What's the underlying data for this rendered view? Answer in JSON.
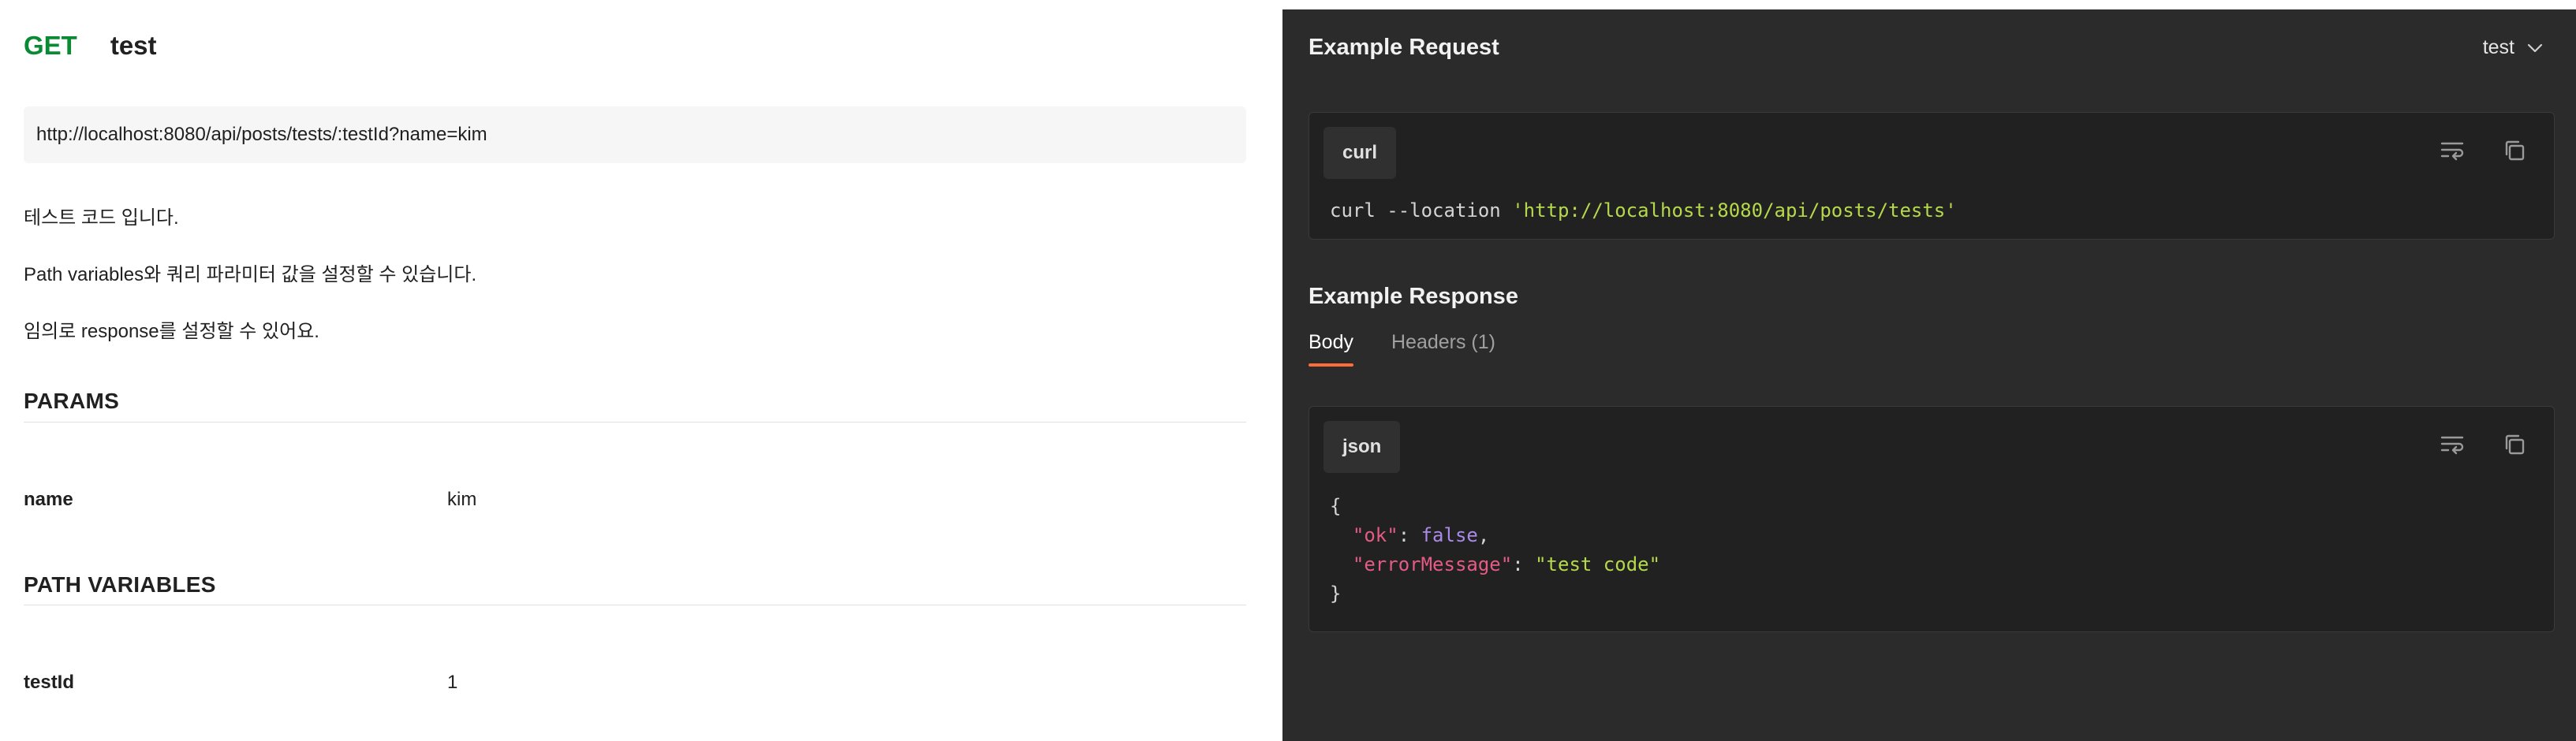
{
  "request": {
    "method": "GET",
    "name": "test",
    "url": "http://localhost:8080/api/posts/tests/:testId?name=kim",
    "description": [
      "테스트 코드 입니다.",
      "Path variables와 쿼리 파라미터 값을 설정할 수 있습니다.",
      "임의로 response를 설정할 수 있어요."
    ]
  },
  "params": {
    "title": "PARAMS",
    "items": [
      {
        "key": "name",
        "value": "kim"
      }
    ]
  },
  "path_variables": {
    "title": "PATH VARIABLES",
    "items": [
      {
        "key": "testId",
        "value": "1"
      }
    ]
  },
  "example_request": {
    "title": "Example Request",
    "selected_example": "test",
    "language": "curl",
    "code": {
      "cmd": "curl",
      "flag": " --location ",
      "url": "'http://localhost:8080/api/posts/tests'"
    }
  },
  "example_response": {
    "title": "Example Response",
    "tabs": [
      "Body",
      "Headers (1)"
    ],
    "active_tab": "Body",
    "language": "json",
    "json": {
      "open": "{",
      "close": "}",
      "key1": "\"ok\"",
      "val1": "false",
      "key2": "\"errorMessage\"",
      "val2": "\"test code\""
    }
  },
  "icons": {
    "wrap": "wrap-lines-icon",
    "copy": "copy-icon",
    "chevron": "chevron-down-icon"
  },
  "colors": {
    "method_get": "#0b8a34",
    "active_tab_underline": "#ff6c37",
    "code_string": "#b5d94a",
    "code_key": "#e55b86",
    "code_boolean": "#a98ae8"
  }
}
